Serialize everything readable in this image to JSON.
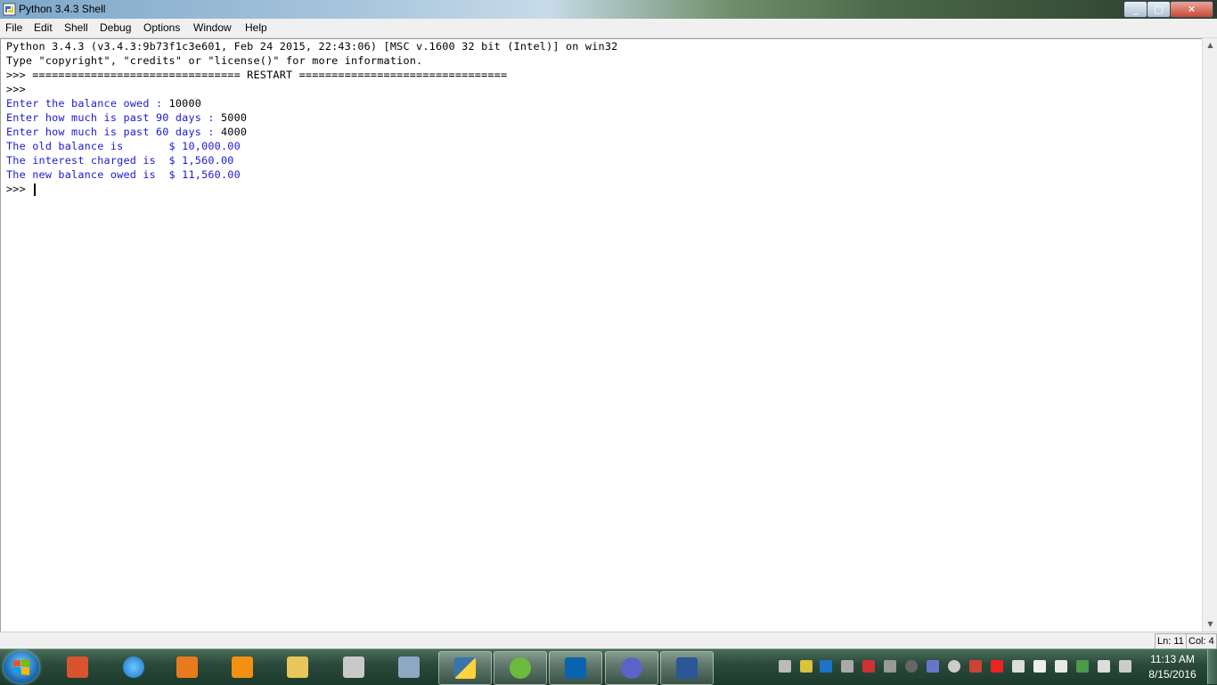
{
  "window": {
    "title": "Python 3.4.3 Shell",
    "minimize": "_",
    "maximize": "□",
    "close": "✕"
  },
  "menu": [
    "File",
    "Edit",
    "Shell",
    "Debug",
    "Options",
    "Window",
    "Help"
  ],
  "shell": {
    "banner1": "Python 3.4.3 (v3.4.3:9b73f1c3e601, Feb 24 2015, 22:43:06) [MSC v.1600 32 bit (Intel)] on win32",
    "banner2": "Type \"copyright\", \"credits\" or \"license()\" for more information.",
    "restart": ">>> ================================ RESTART ================================",
    "prompt1": ">>> ",
    "q1": "Enter the balance owed : ",
    "a1": "10000",
    "q2": "Enter how much is past 90 days : ",
    "a2": "5000",
    "q3": "Enter how much is past 60 days : ",
    "a3": "4000",
    "r1": "The old balance is       $ 10,000.00",
    "r2": "The interest charged is  $ 1,560.00",
    "r3": "The new balance owed is  $ 11,560.00",
    "prompt2": ">>> "
  },
  "status": {
    "line": "Ln: 11",
    "col": "Col: 4"
  },
  "taskbar": {
    "apps": [
      "start-orb",
      "presentation-app",
      "internet-explorer",
      "media-player",
      "amazon",
      "file-explorer",
      "scanner",
      "calculator",
      "python",
      "android-studio",
      "outlook",
      "infinity-app",
      "word"
    ],
    "clock_time": "11:13 AM",
    "clock_date": "8/15/2016"
  }
}
